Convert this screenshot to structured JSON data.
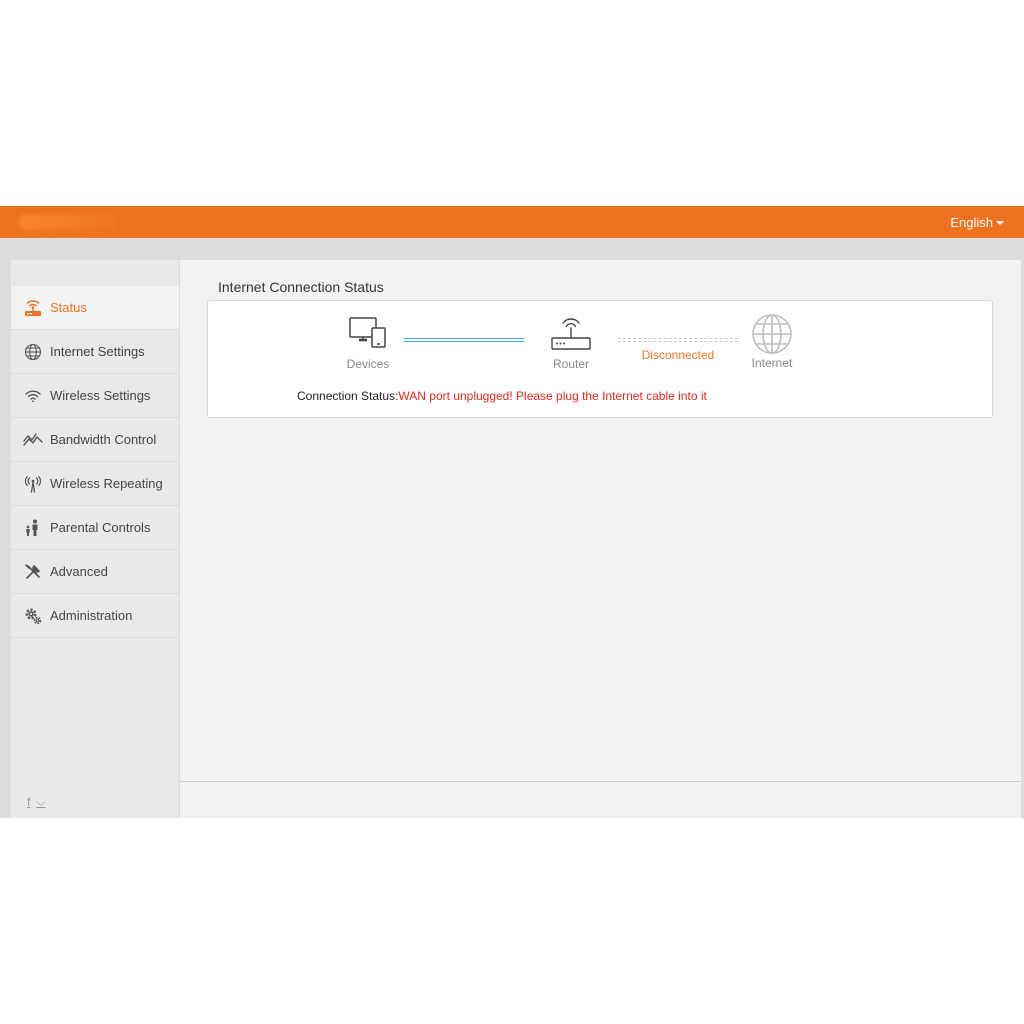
{
  "header": {
    "language": "English",
    "accent_color": "#ee7120"
  },
  "sidebar": {
    "items": [
      {
        "label": "Status",
        "icon": "router-signal-icon",
        "active": true
      },
      {
        "label": "Internet Settings",
        "icon": "globe-icon",
        "active": false
      },
      {
        "label": "Wireless Settings",
        "icon": "wifi-icon",
        "active": false
      },
      {
        "label": "Bandwidth Control",
        "icon": "bandwidth-graph-icon",
        "active": false
      },
      {
        "label": "Wireless Repeating",
        "icon": "antenna-icon",
        "active": false
      },
      {
        "label": "Parental Controls",
        "icon": "parent-child-icon",
        "active": false
      },
      {
        "label": "Advanced",
        "icon": "tools-icon",
        "active": false
      },
      {
        "label": "Administration",
        "icon": "gears-icon",
        "active": false
      }
    ],
    "social": {
      "facebook": "f",
      "twitter": "⌵"
    }
  },
  "main": {
    "title": "Internet Connection Status",
    "diagram": {
      "devices_label": "Devices",
      "router_label": "Router",
      "internet_label": "Internet",
      "link_status": "Disconnected"
    },
    "connection_status_label": "Connection Status:",
    "connection_status_message": "WAN port unplugged! Please plug the Internet cable into it"
  }
}
